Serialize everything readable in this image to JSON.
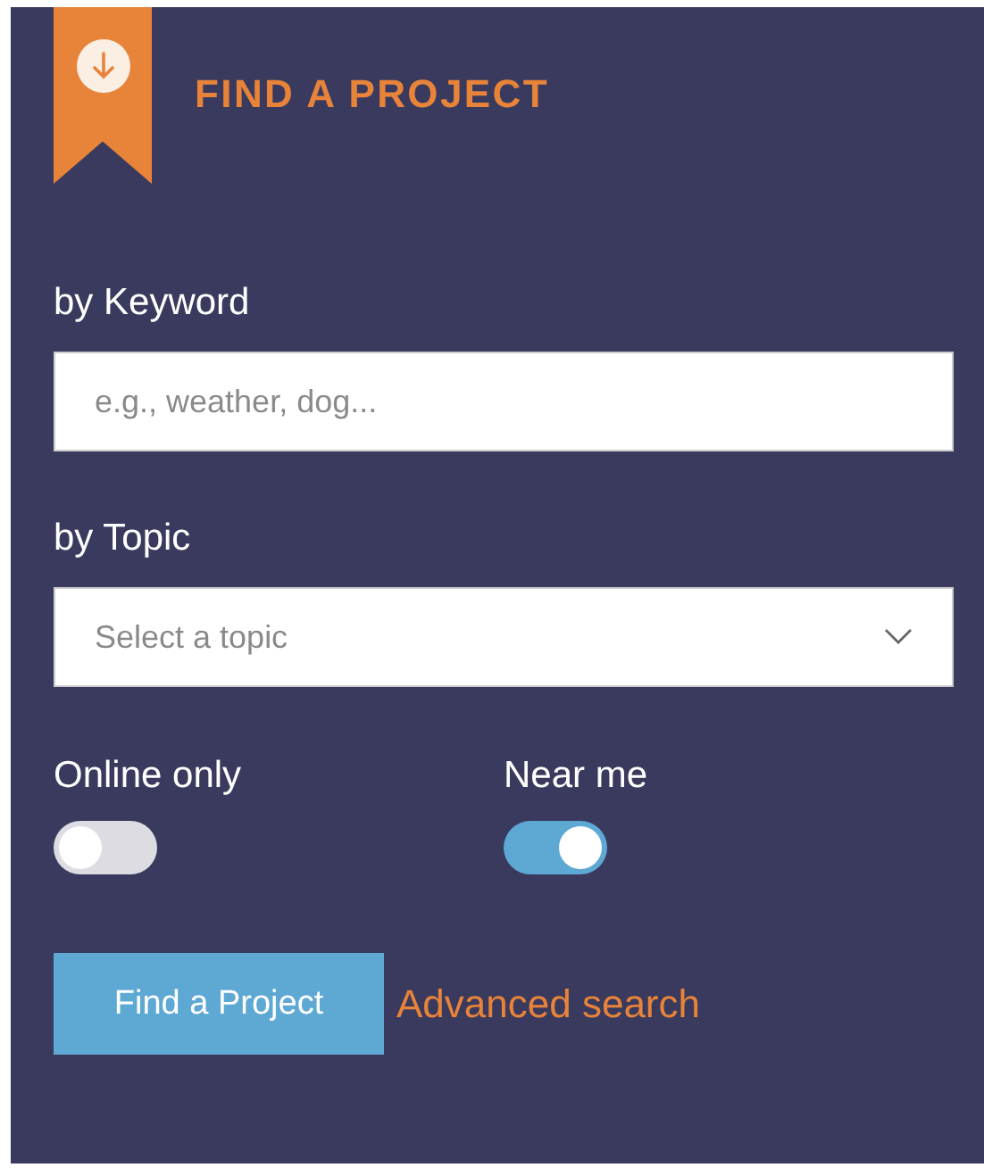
{
  "header": {
    "title": "FIND A PROJECT"
  },
  "keyword": {
    "label": "by Keyword",
    "placeholder": "e.g., weather, dog..."
  },
  "topic": {
    "label": "by Topic",
    "placeholder": "Select a topic"
  },
  "toggles": [
    {
      "label": "Online only",
      "on": false
    },
    {
      "label": "Near me",
      "on": true
    }
  ],
  "actions": {
    "submit": "Find a Project",
    "link": "Advanced search"
  }
}
